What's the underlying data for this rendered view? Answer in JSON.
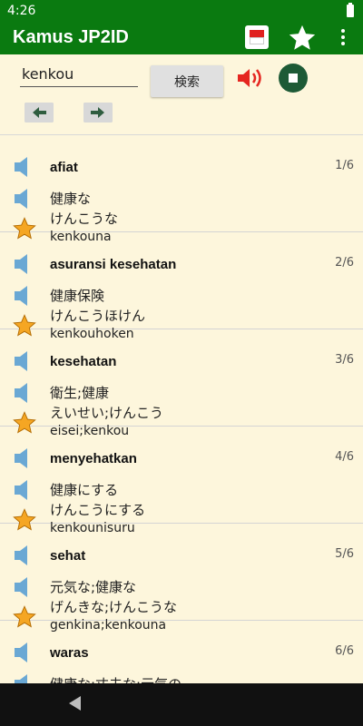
{
  "status_bar": {
    "time": "4:26"
  },
  "app_bar": {
    "title": "Kamus JP2ID"
  },
  "search": {
    "query": "kenkou",
    "button_label": "検索"
  },
  "results": [
    {
      "word": "afiat",
      "count": "1/6",
      "kanji": "健康な",
      "kana": "けんこうな",
      "romaji": "kenkouna"
    },
    {
      "word": "asuransi kesehatan",
      "count": "2/6",
      "kanji": "健康保険",
      "kana": "けんこうほけん",
      "romaji": "kenkouhoken"
    },
    {
      "word": "kesehatan",
      "count": "3/6",
      "kanji": "衛生;健康",
      "kana": "えいせい;けんこう",
      "romaji": "eisei;kenkou"
    },
    {
      "word": "menyehatkan",
      "count": "4/6",
      "kanji": "健康にする",
      "kana": "けんこうにする",
      "romaji": "kenkounisuru"
    },
    {
      "word": "sehat",
      "count": "5/6",
      "kanji": "元気な;健康な",
      "kana": "げんきな;けんこうな",
      "romaji": "genkina;kenkouna"
    },
    {
      "word": "waras",
      "count": "6/6",
      "kanji": "健康な;丈夫な;元気の",
      "kana": "",
      "romaji": ""
    }
  ],
  "colors": {
    "primary": "#0a7a10",
    "background": "#fdf6dc",
    "stop": "#1d5a36",
    "speaker_blue": "#6aa8d4",
    "star_gold": "#f5a623"
  }
}
